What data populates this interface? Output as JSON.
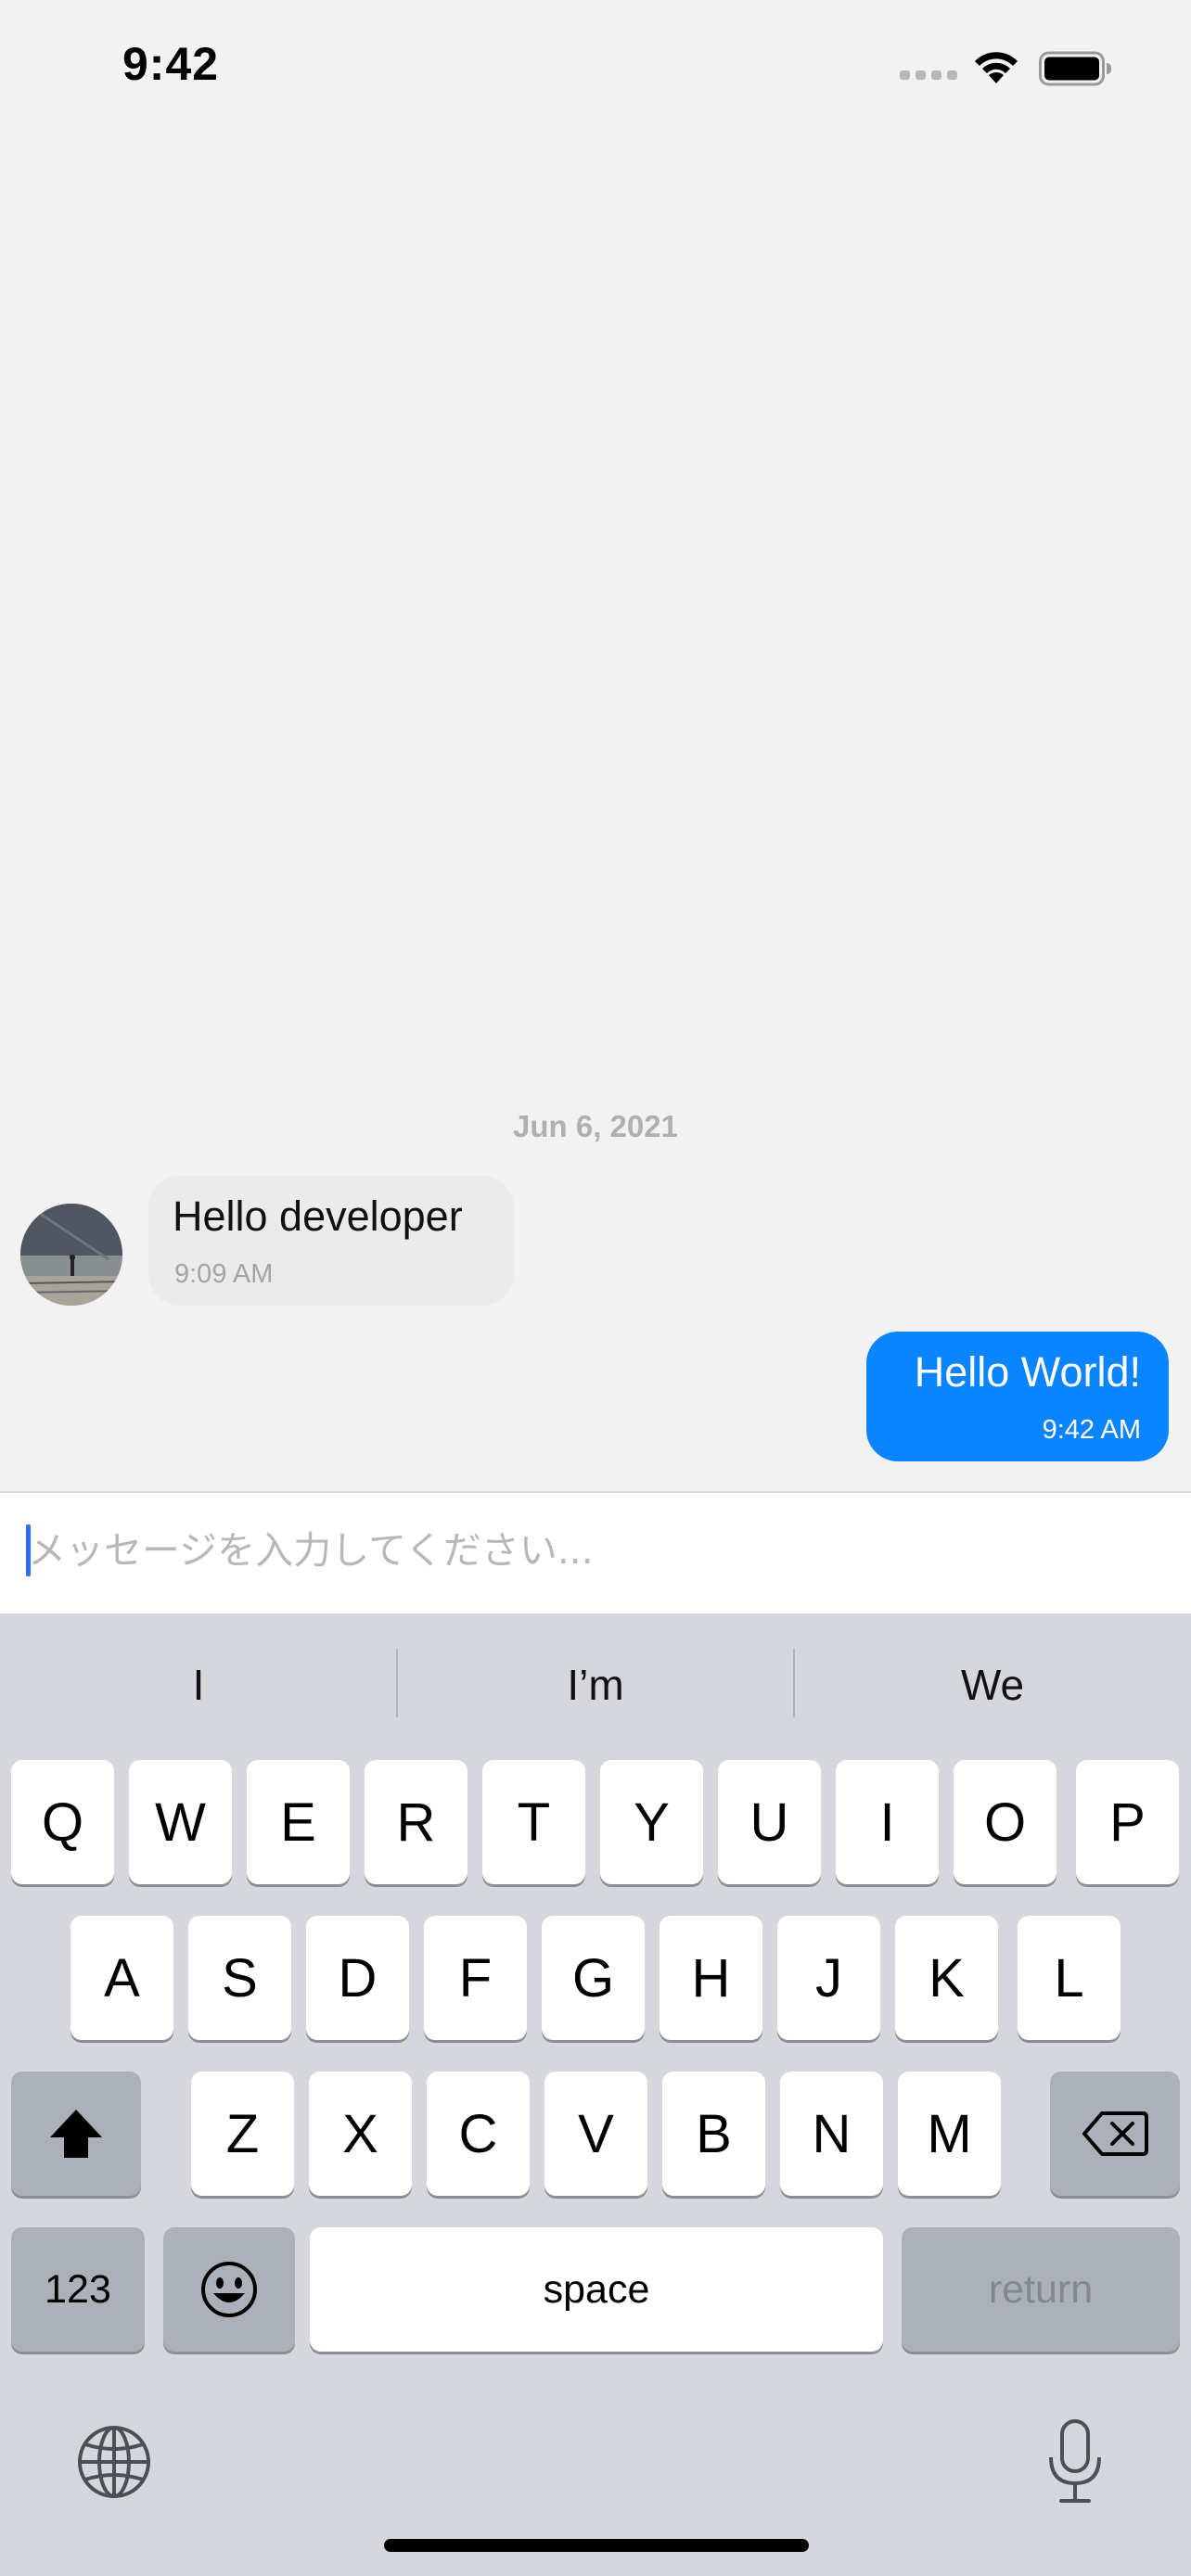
{
  "status_bar": {
    "time": "9:42"
  },
  "chat": {
    "date_separator": "Jun 6, 2021",
    "messages": [
      {
        "direction": "incoming",
        "text": "Hello developer",
        "time": "9:09 AM"
      },
      {
        "direction": "outgoing",
        "text": "Hello World!",
        "time": "9:42 AM"
      }
    ]
  },
  "input": {
    "placeholder": "メッセージを入力してください...",
    "value": ""
  },
  "keyboard": {
    "suggestions": [
      "I",
      "I’m",
      "We"
    ],
    "row1": [
      "Q",
      "W",
      "E",
      "R",
      "T",
      "Y",
      "U",
      "I",
      "O",
      "P"
    ],
    "row2": [
      "A",
      "S",
      "D",
      "F",
      "G",
      "H",
      "J",
      "K",
      "L"
    ],
    "row3": [
      "Z",
      "X",
      "C",
      "V",
      "B",
      "N",
      "M"
    ],
    "numbers_label": "123",
    "space_label": "space",
    "return_label": "return",
    "icons": [
      "shift-icon",
      "backspace-icon",
      "emoji-icon",
      "globe-icon",
      "microphone-icon"
    ]
  },
  "colors": {
    "outgoing_bubble": "#0a84ff",
    "incoming_bubble": "#ebebeb",
    "keyboard_bg": "#d5d7dc"
  }
}
